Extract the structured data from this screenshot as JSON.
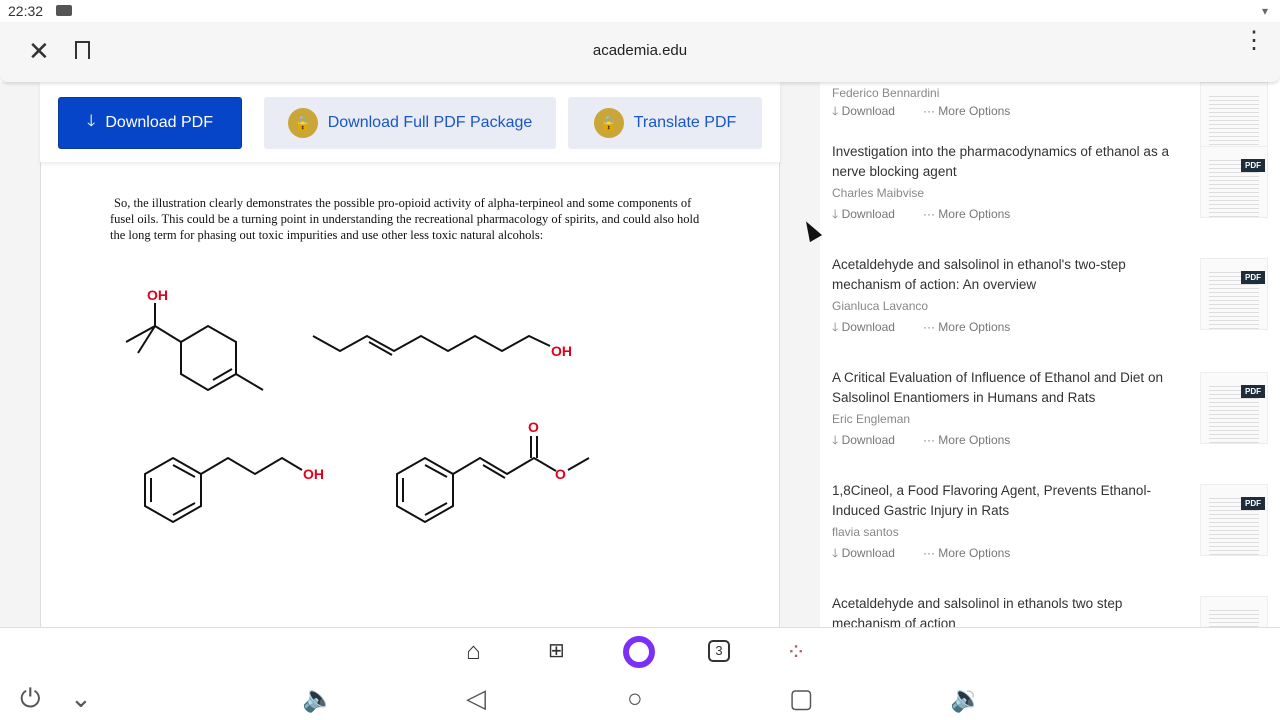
{
  "status": {
    "time": "22:32"
  },
  "browser": {
    "url": "academia.edu",
    "close_icon": "close-icon",
    "bookmark_icon": "bookmark-icon",
    "menu_icon": "more-vert-icon"
  },
  "toolbar": {
    "download_pdf": "Download PDF",
    "download_package": "Download Full PDF Package",
    "translate": "Translate PDF"
  },
  "document": {
    "paragraph": "So, the illustration clearly demonstrates the possible pro-opioid activity of alpha-terpineol and some components of fusel oils. This could be a turning point in understanding the recreational pharmacology of spirits, and could also hold the long term for phasing out toxic impurities and use other less toxic natural alcohols:",
    "labels": {
      "oh": "OH",
      "o": "O"
    }
  },
  "related": {
    "download_label": "Download",
    "more_label": "More Options",
    "pdf_badge": "PDF",
    "items": [
      {
        "title": "",
        "author": "Federico Bennardini"
      },
      {
        "title": "Investigation into the pharmacodynamics of ethanol as a nerve blocking agent",
        "author": "Charles Maibvise"
      },
      {
        "title": "Acetaldehyde and salsolinol in ethanol's two-step mechanism of action: An overview",
        "author": "Gianluca Lavanco"
      },
      {
        "title": "A Critical Evaluation of Influence of Ethanol and Diet on Salsolinol Enantiomers in Humans and Rats",
        "author": "Eric Engleman"
      },
      {
        "title": "1,8Cineol, a Food Flavoring Agent, Prevents Ethanol-Induced Gastric Injury in Rats",
        "author": "flavia santos"
      },
      {
        "title": "Acetaldehyde and salsolinol in ethanols two step mechanism of action",
        "author": ""
      }
    ]
  },
  "dock": {
    "tabs_count": "3"
  },
  "colors": {
    "primary": "#0645c8",
    "accent_light": "#e9ecf4",
    "lock": "#c9a637",
    "oh_red": "#e0001b",
    "alice": "#7b2ff7"
  }
}
